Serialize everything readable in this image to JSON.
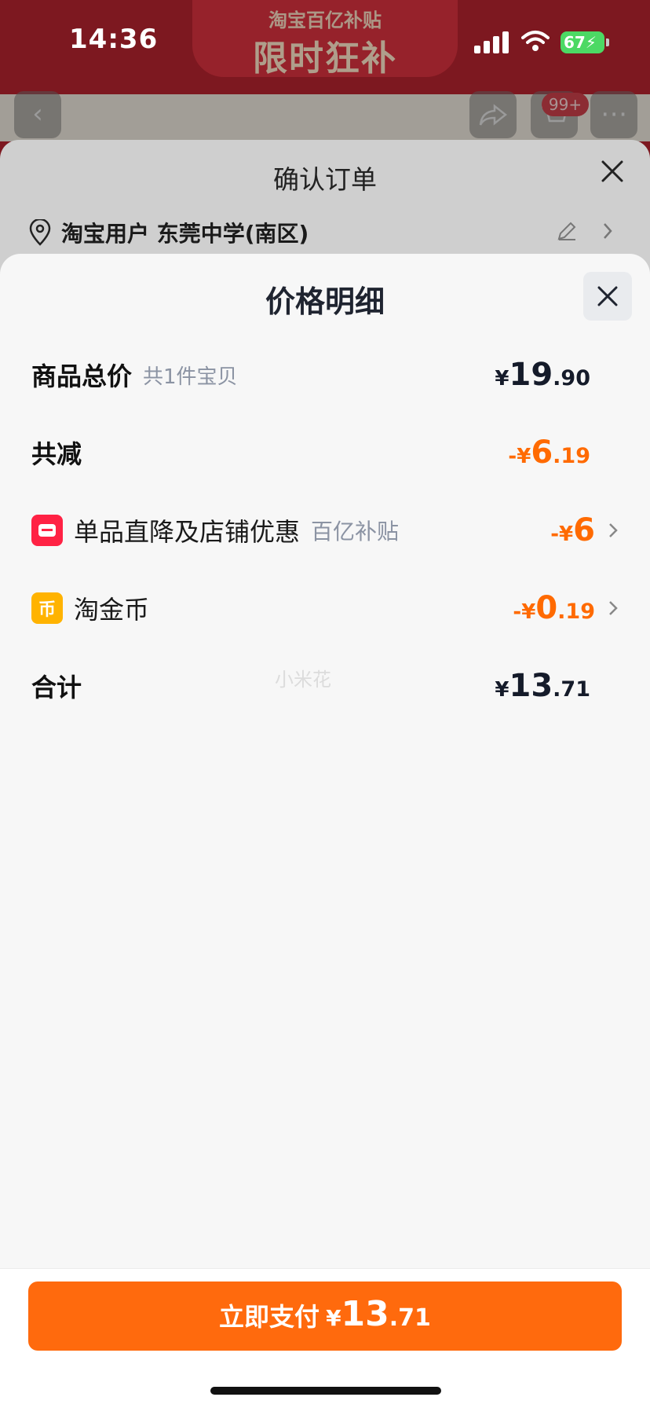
{
  "status_bar": {
    "time": "14:36",
    "battery": "67"
  },
  "background_page": {
    "banner_top": "淘宝百亿补贴",
    "banner_main": "限时狂补",
    "cart_badge": "99+"
  },
  "order_sheet": {
    "title": "确认订单",
    "address": "淘宝用户 东莞中学(南区)"
  },
  "price_detail": {
    "title": "价格明细",
    "rows": {
      "total": {
        "label": "商品总价",
        "sub": "共1件宝贝",
        "currency": "¥",
        "int": "19",
        "dec": ".90"
      },
      "discount": {
        "label": "共减",
        "currency": "-¥",
        "int": "6",
        "dec": ".19"
      },
      "store_discount": {
        "label": "单品直降及店铺优惠",
        "sub": "百亿补贴",
        "currency": "-¥",
        "int": "6",
        "dec": ""
      },
      "coins": {
        "label": "淘金币",
        "icon_text": "币",
        "currency": "-¥",
        "int": "0",
        "dec": ".19"
      },
      "sum": {
        "label": "合计",
        "currency": "¥",
        "int": "13",
        "dec": ".71"
      }
    },
    "watermark": "小米花"
  },
  "pay_button": {
    "label": "立即支付",
    "currency": "¥",
    "int": "13",
    "dec": ".71"
  },
  "colors": {
    "accent": "#ff6a00",
    "red_badge": "#ff2244",
    "coin_badge": "#ffb300"
  }
}
